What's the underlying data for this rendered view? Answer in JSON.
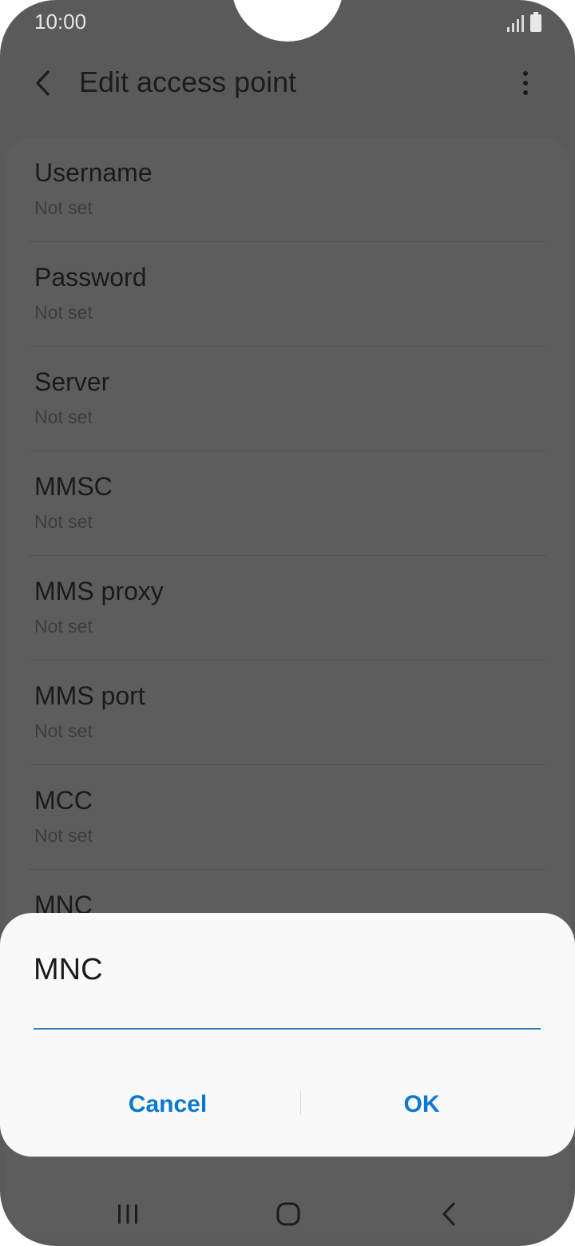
{
  "status_bar": {
    "time": "10:00",
    "icons": [
      "signal-icon",
      "battery-icon"
    ]
  },
  "header": {
    "title": "Edit access point",
    "back_icon": "chevron-left-icon",
    "menu_icon": "more-vertical-icon"
  },
  "settings": {
    "items": [
      {
        "title": "Username",
        "value": "Not set"
      },
      {
        "title": "Password",
        "value": "Not set"
      },
      {
        "title": "Server",
        "value": "Not set"
      },
      {
        "title": "MMSC",
        "value": "Not set"
      },
      {
        "title": "MMS proxy",
        "value": "Not set"
      },
      {
        "title": "MMS port",
        "value": "Not set"
      },
      {
        "title": "MCC",
        "value": "Not set"
      },
      {
        "title": "MNC",
        "value": ""
      }
    ]
  },
  "dialog": {
    "title": "MNC",
    "input_value": "",
    "cancel_label": "Cancel",
    "ok_label": "OK"
  },
  "nav_bar": {
    "recents_icon": "recents-icon",
    "home_icon": "home-icon",
    "back_icon": "back-icon"
  },
  "colors": {
    "scrim_background": "#5a5a5a",
    "dialog_background": "#f9f9f9",
    "accent": "#0b78cf",
    "input_underline": "#2f7bbd"
  }
}
